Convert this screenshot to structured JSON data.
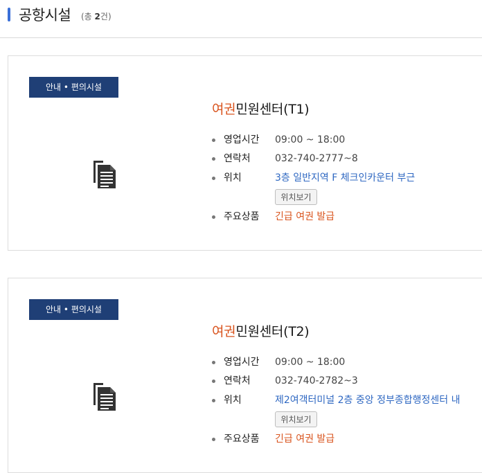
{
  "header": {
    "title": "공항시설",
    "count_prefix": "(총 ",
    "count_num": "2",
    "count_suffix": "건)"
  },
  "facilities": [
    {
      "category": "안내 • 편의시설",
      "title_highlight": "여권",
      "title_rest": "민원센터(T1)",
      "hours_label": "영업시간",
      "hours": "09:00 ~ 18:00",
      "contact_label": "연락처",
      "contact": "032-740-2777~8",
      "location_label": "위치",
      "location": "3층 일반지역 F 체크인카운터 부근",
      "location_button": "위치보기",
      "products_label": "주요상품",
      "products": "긴급 여권 발급"
    },
    {
      "category": "안내 • 편의시설",
      "title_highlight": "여권",
      "title_rest": "민원센터(T2)",
      "hours_label": "영업시간",
      "hours": "09:00 ~ 18:00",
      "contact_label": "연락처",
      "contact": "032-740-2782~3",
      "location_label": "위치",
      "location": "제2여객터미널 2층 중앙 정부종합행정센터 내",
      "location_button": "위치보기",
      "products_label": "주요상품",
      "products": "긴급 여권 발급"
    }
  ],
  "colors": {
    "accent": "#d9541e",
    "link": "#2f68c2",
    "category_bg": "#1f3f76",
    "header_bar": "#3a6fd8"
  },
  "icons": {
    "facility": "document-copy-icon"
  }
}
